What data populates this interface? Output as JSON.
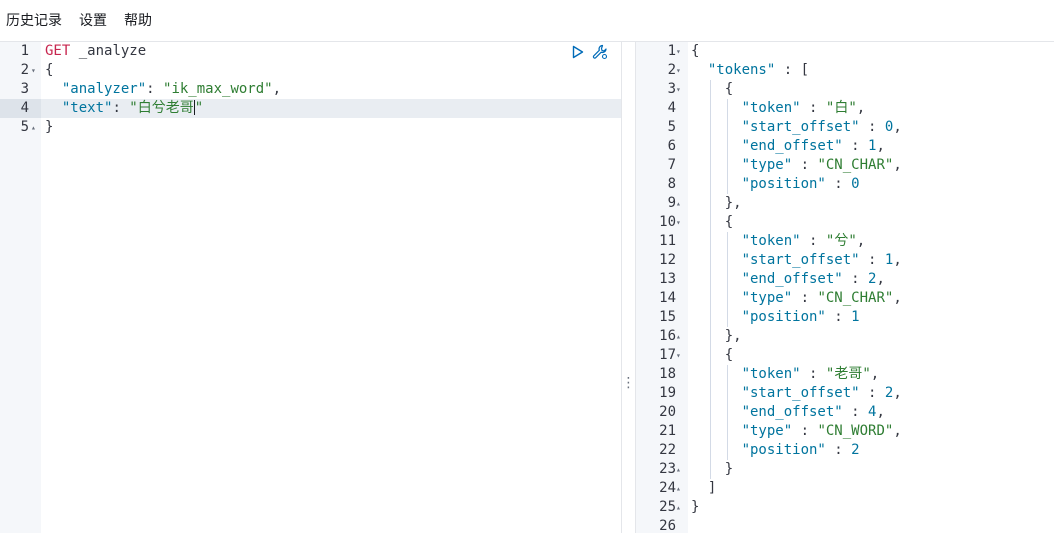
{
  "menu": {
    "history": "历史记录",
    "settings": "设置",
    "help": "帮助"
  },
  "request": {
    "method": "GET",
    "endpoint": "_analyze",
    "lines": [
      {
        "n": "1",
        "fold": ""
      },
      {
        "n": "2",
        "fold": "▾"
      },
      {
        "n": "3",
        "fold": ""
      },
      {
        "n": "4",
        "fold": ""
      },
      {
        "n": "5",
        "fold": "▴"
      }
    ],
    "analyzer_key": "\"analyzer\"",
    "analyzer_value": "\"ik_max_word\"",
    "text_key": "\"text\"",
    "text_value_open": "\"白兮老哥",
    "text_value_close": "\""
  },
  "icons": {
    "play": "play-icon",
    "wrench": "wrench-icon",
    "divider": "drag-handle-icon"
  },
  "response": {
    "line_numbers": [
      "1",
      "2",
      "3",
      "4",
      "5",
      "6",
      "7",
      "8",
      "9",
      "10",
      "11",
      "12",
      "13",
      "14",
      "15",
      "16",
      "17",
      "18",
      "19",
      "20",
      "21",
      "22",
      "23",
      "24",
      "25",
      "26"
    ],
    "folds": [
      "▾",
      "▾",
      "▾",
      "",
      "",
      "",
      "",
      "",
      "▴",
      "▾",
      "",
      "",
      "",
      "",
      "",
      "▴",
      "▾",
      "",
      "",
      "",
      "",
      "",
      "▴",
      "▴",
      "▴",
      ""
    ],
    "tokens_key": "\"tokens\"",
    "items": [
      {
        "token": "\"白\"",
        "start_offset": "0",
        "end_offset": "1",
        "type": "\"CN_CHAR\"",
        "position": "0"
      },
      {
        "token": "\"兮\"",
        "start_offset": "1",
        "end_offset": "2",
        "type": "\"CN_CHAR\"",
        "position": "1"
      },
      {
        "token": "\"老哥\"",
        "start_offset": "2",
        "end_offset": "4",
        "type": "\"CN_WORD\"",
        "position": "2"
      }
    ],
    "keys": {
      "token": "\"token\"",
      "start_offset": "\"start_offset\"",
      "end_offset": "\"end_offset\"",
      "type": "\"type\"",
      "position": "\"position\""
    }
  },
  "colors": {
    "method": "#c7254e",
    "key": "#00749e",
    "string": "#2e7d32",
    "active_line": "#e9edf2"
  }
}
